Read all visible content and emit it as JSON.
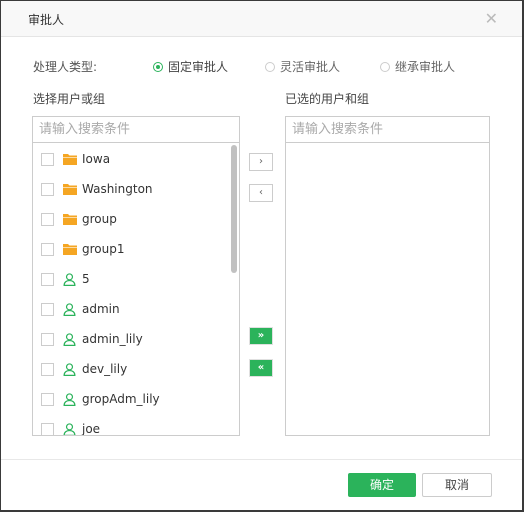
{
  "dialog": {
    "title": "审批人",
    "close_icon": "close-icon"
  },
  "type_row": {
    "label": "处理人类型:",
    "options": [
      {
        "label": "固定审批人",
        "checked": true
      },
      {
        "label": "灵活审批人",
        "checked": false
      },
      {
        "label": "继承审批人",
        "checked": false
      }
    ]
  },
  "left_panel": {
    "label": "选择用户或组",
    "search_placeholder": "请输入搜索条件",
    "search_value": "",
    "items": [
      {
        "name": "Iowa",
        "type": "group",
        "icon": "folder-icon",
        "checked": false
      },
      {
        "name": "Washington",
        "type": "group",
        "icon": "folder-icon",
        "checked": false
      },
      {
        "name": "group",
        "type": "group",
        "icon": "folder-icon",
        "checked": false
      },
      {
        "name": "group1",
        "type": "group",
        "icon": "folder-icon",
        "checked": false
      },
      {
        "name": "5",
        "type": "user",
        "icon": "user-icon",
        "checked": false
      },
      {
        "name": "admin",
        "type": "user",
        "icon": "user-icon",
        "checked": false
      },
      {
        "name": "admin_lily",
        "type": "user",
        "icon": "user-icon",
        "checked": false
      },
      {
        "name": "dev_lily",
        "type": "user",
        "icon": "user-icon",
        "checked": false
      },
      {
        "name": "gropAdm_lily",
        "type": "user",
        "icon": "user-icon",
        "checked": false
      },
      {
        "name": "joe",
        "type": "user",
        "icon": "user-icon",
        "checked": false
      }
    ]
  },
  "right_panel": {
    "label": "已选的用户和组",
    "search_placeholder": "请输入搜索条件",
    "search_value": "",
    "items": []
  },
  "move_buttons": {
    "add": "›",
    "remove": "‹",
    "add_all": "»",
    "remove_all": "«"
  },
  "footer": {
    "ok_label": "确定",
    "cancel_label": "取消"
  },
  "colors": {
    "accent": "#2bb35b",
    "folder": "#f5a623",
    "user": "#2bb35b"
  }
}
